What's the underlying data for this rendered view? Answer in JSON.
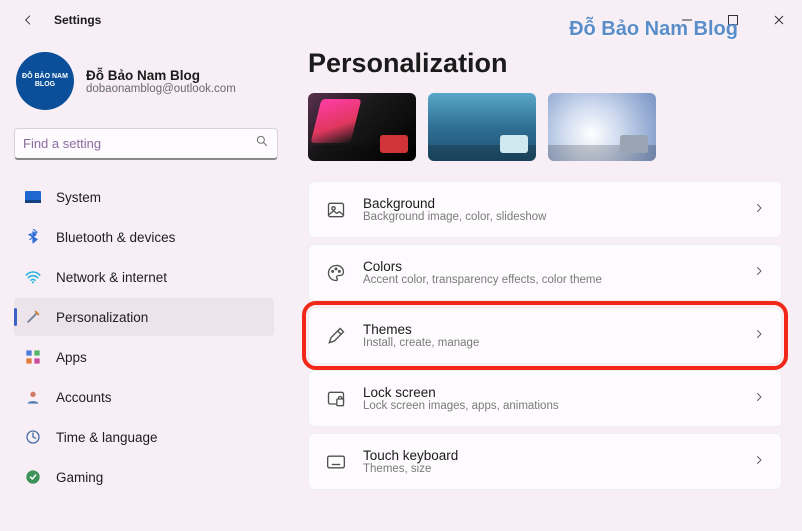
{
  "window": {
    "title": "Settings"
  },
  "watermark": "Đỗ Bảo Nam Blog",
  "profile": {
    "avatar_text": "ĐỖ BẢO NAM BLOG",
    "name": "Đỗ Bảo Nam Blog",
    "email": "dobaonamblog@outlook.com"
  },
  "search": {
    "placeholder": "Find a setting"
  },
  "sidebar": {
    "items": [
      {
        "label": "System"
      },
      {
        "label": "Bluetooth & devices"
      },
      {
        "label": "Network & internet"
      },
      {
        "label": "Personalization"
      },
      {
        "label": "Apps"
      },
      {
        "label": "Accounts"
      },
      {
        "label": "Time & language"
      },
      {
        "label": "Gaming"
      }
    ]
  },
  "main": {
    "title": "Personalization",
    "cards": [
      {
        "title": "Background",
        "sub": "Background image, color, slideshow"
      },
      {
        "title": "Colors",
        "sub": "Accent color, transparency effects, color theme"
      },
      {
        "title": "Themes",
        "sub": "Install, create, manage"
      },
      {
        "title": "Lock screen",
        "sub": "Lock screen images, apps, animations"
      },
      {
        "title": "Touch keyboard",
        "sub": "Themes, size"
      }
    ]
  }
}
